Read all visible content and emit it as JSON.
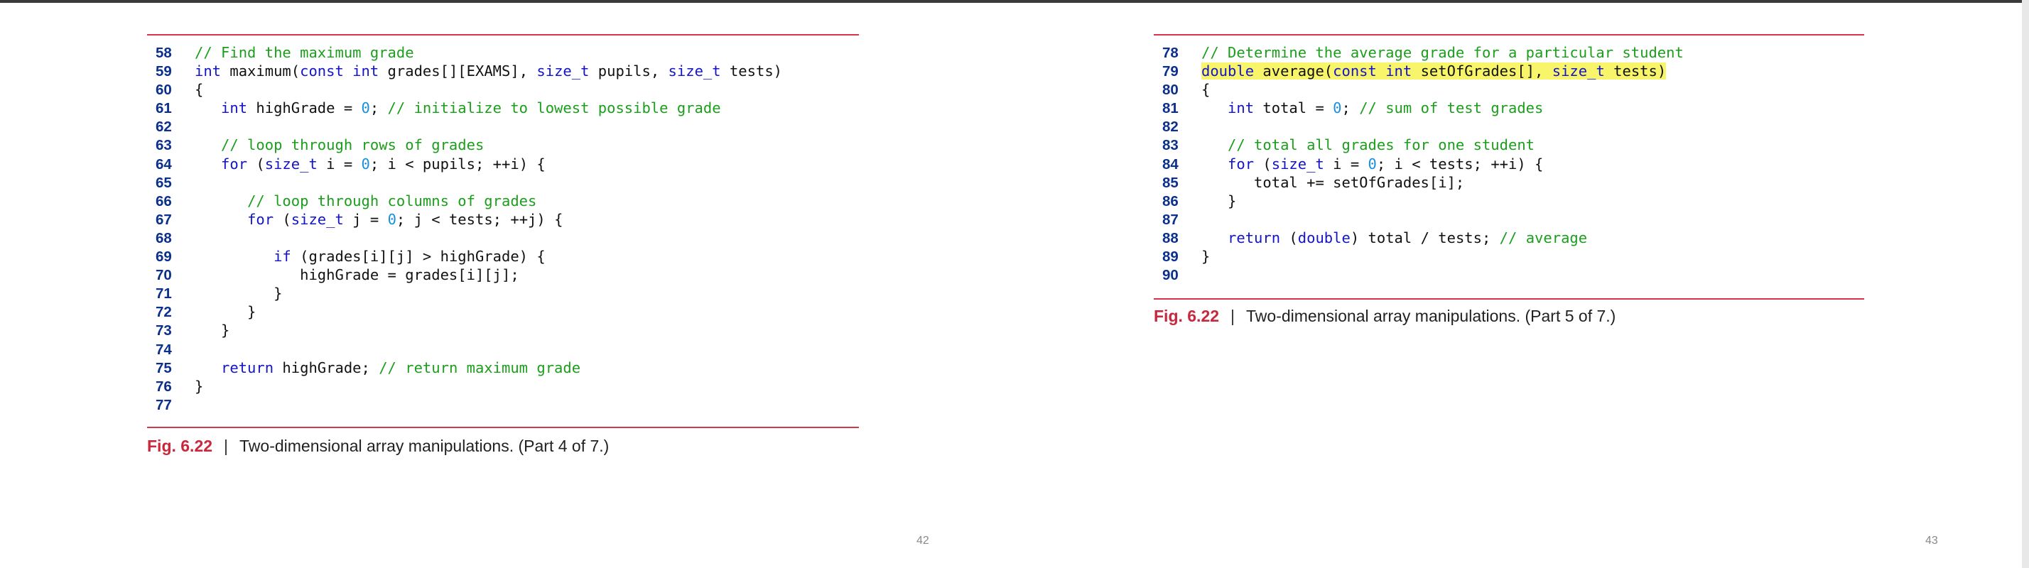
{
  "pages": [
    {
      "lines": [
        {
          "num": "58",
          "tokens": [
            {
              "t": "// Find the maximum grade",
              "c": "cm"
            }
          ]
        },
        {
          "num": "59",
          "tokens": [
            {
              "t": "int",
              "c": "kw"
            },
            {
              "t": " maximum(",
              "c": "pl"
            },
            {
              "t": "const int",
              "c": "kw"
            },
            {
              "t": " grades[][EXAMS], ",
              "c": "pl"
            },
            {
              "t": "size_t",
              "c": "kw"
            },
            {
              "t": " pupils, ",
              "c": "pl"
            },
            {
              "t": "size_t",
              "c": "kw"
            },
            {
              "t": " tests)",
              "c": "pl"
            }
          ]
        },
        {
          "num": "60",
          "tokens": [
            {
              "t": "{",
              "c": "pl"
            }
          ]
        },
        {
          "num": "61",
          "tokens": [
            {
              "t": "   ",
              "c": "pl"
            },
            {
              "t": "int",
              "c": "kw"
            },
            {
              "t": " highGrade = ",
              "c": "pl"
            },
            {
              "t": "0",
              "c": "num"
            },
            {
              "t": "; ",
              "c": "pl"
            },
            {
              "t": "// initialize to lowest possible grade",
              "c": "cm"
            }
          ]
        },
        {
          "num": "62",
          "tokens": []
        },
        {
          "num": "63",
          "tokens": [
            {
              "t": "   ",
              "c": "pl"
            },
            {
              "t": "// loop through rows of grades",
              "c": "cm"
            }
          ]
        },
        {
          "num": "64",
          "tokens": [
            {
              "t": "   ",
              "c": "pl"
            },
            {
              "t": "for",
              "c": "kw"
            },
            {
              "t": " (",
              "c": "pl"
            },
            {
              "t": "size_t",
              "c": "kw"
            },
            {
              "t": " i = ",
              "c": "pl"
            },
            {
              "t": "0",
              "c": "num"
            },
            {
              "t": "; i < pupils; ++i) {",
              "c": "pl"
            }
          ]
        },
        {
          "num": "65",
          "tokens": []
        },
        {
          "num": "66",
          "tokens": [
            {
              "t": "      ",
              "c": "pl"
            },
            {
              "t": "// loop through columns of grades",
              "c": "cm"
            }
          ]
        },
        {
          "num": "67",
          "tokens": [
            {
              "t": "      ",
              "c": "pl"
            },
            {
              "t": "for",
              "c": "kw"
            },
            {
              "t": " (",
              "c": "pl"
            },
            {
              "t": "size_t",
              "c": "kw"
            },
            {
              "t": " j = ",
              "c": "pl"
            },
            {
              "t": "0",
              "c": "num"
            },
            {
              "t": "; j < tests; ++j) {",
              "c": "pl"
            }
          ]
        },
        {
          "num": "68",
          "tokens": []
        },
        {
          "num": "69",
          "tokens": [
            {
              "t": "         ",
              "c": "pl"
            },
            {
              "t": "if",
              "c": "kw"
            },
            {
              "t": " (grades[i][j] > highGrade) {",
              "c": "pl"
            }
          ]
        },
        {
          "num": "70",
          "tokens": [
            {
              "t": "            highGrade = grades[i][j];",
              "c": "pl"
            }
          ]
        },
        {
          "num": "71",
          "tokens": [
            {
              "t": "         }",
              "c": "pl"
            }
          ]
        },
        {
          "num": "72",
          "tokens": [
            {
              "t": "      }",
              "c": "pl"
            }
          ]
        },
        {
          "num": "73",
          "tokens": [
            {
              "t": "   }",
              "c": "pl"
            }
          ]
        },
        {
          "num": "74",
          "tokens": []
        },
        {
          "num": "75",
          "tokens": [
            {
              "t": "   ",
              "c": "pl"
            },
            {
              "t": "return",
              "c": "kw"
            },
            {
              "t": " highGrade; ",
              "c": "pl"
            },
            {
              "t": "// return maximum grade",
              "c": "cm"
            }
          ]
        },
        {
          "num": "76",
          "tokens": [
            {
              "t": "}",
              "c": "pl"
            }
          ]
        },
        {
          "num": "77",
          "tokens": []
        }
      ],
      "caption": {
        "fig": "Fig. 6.22",
        "sep": "|",
        "text": "Two-dimensional array manipulations. (Part 4 of 7.)"
      },
      "page_number": "42"
    },
    {
      "lines": [
        {
          "num": "78",
          "tokens": [
            {
              "t": "// Determine the average grade for a particular student",
              "c": "cm"
            }
          ]
        },
        {
          "num": "79",
          "tokens": [
            {
              "t": "double",
              "c": "kw",
              "hl": true
            },
            {
              "t": " average(",
              "c": "pl",
              "hl": true
            },
            {
              "t": "const int",
              "c": "kw",
              "hl": true
            },
            {
              "t": " setOfGrades[], ",
              "c": "pl",
              "hl": true
            },
            {
              "t": "size_t",
              "c": "kw",
              "hl": true
            },
            {
              "t": " tests)",
              "c": "pl",
              "hl": true
            }
          ]
        },
        {
          "num": "80",
          "tokens": [
            {
              "t": "{",
              "c": "pl"
            }
          ]
        },
        {
          "num": "81",
          "tokens": [
            {
              "t": "   ",
              "c": "pl"
            },
            {
              "t": "int",
              "c": "kw"
            },
            {
              "t": " total = ",
              "c": "pl"
            },
            {
              "t": "0",
              "c": "num"
            },
            {
              "t": "; ",
              "c": "pl"
            },
            {
              "t": "// sum of test grades",
              "c": "cm"
            }
          ]
        },
        {
          "num": "82",
          "tokens": []
        },
        {
          "num": "83",
          "tokens": [
            {
              "t": "   ",
              "c": "pl"
            },
            {
              "t": "// total all grades for one student",
              "c": "cm"
            }
          ]
        },
        {
          "num": "84",
          "tokens": [
            {
              "t": "   ",
              "c": "pl"
            },
            {
              "t": "for",
              "c": "kw"
            },
            {
              "t": " (",
              "c": "pl"
            },
            {
              "t": "size_t",
              "c": "kw"
            },
            {
              "t": " i = ",
              "c": "pl"
            },
            {
              "t": "0",
              "c": "num"
            },
            {
              "t": "; i < tests; ++i) {",
              "c": "pl"
            }
          ]
        },
        {
          "num": "85",
          "tokens": [
            {
              "t": "      total += setOfGrades[i];",
              "c": "pl"
            }
          ]
        },
        {
          "num": "86",
          "tokens": [
            {
              "t": "   }",
              "c": "pl"
            }
          ]
        },
        {
          "num": "87",
          "tokens": []
        },
        {
          "num": "88",
          "tokens": [
            {
              "t": "   ",
              "c": "pl"
            },
            {
              "t": "return",
              "c": "kw"
            },
            {
              "t": " (",
              "c": "pl"
            },
            {
              "t": "double",
              "c": "kw"
            },
            {
              "t": ") total / tests; ",
              "c": "pl"
            },
            {
              "t": "// average",
              "c": "cm"
            }
          ]
        },
        {
          "num": "89",
          "tokens": [
            {
              "t": "}",
              "c": "pl"
            }
          ]
        },
        {
          "num": "90",
          "tokens": []
        }
      ],
      "caption": {
        "fig": "Fig. 6.22",
        "sep": "|",
        "text": "Two-dimensional array manipulations. (Part 5 of 7.)"
      },
      "page_number": "43"
    }
  ]
}
